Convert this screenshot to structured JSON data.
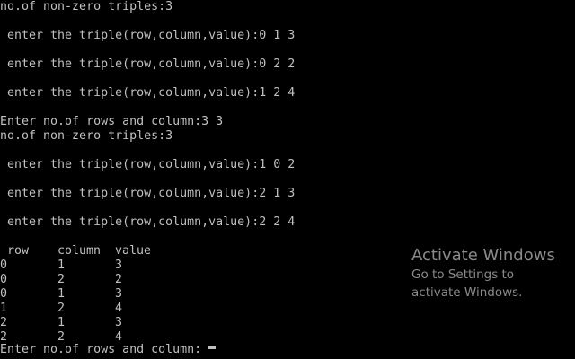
{
  "colors": {
    "background": "#000000",
    "console_text": "#c0c0c0",
    "watermark_text": "#8a8a8a"
  },
  "console": {
    "lines": [
      "no.of non-zero triples:3",
      "",
      " enter the triple(row,column,value):0 1 3",
      "",
      " enter the triple(row,column,value):0 2 2",
      "",
      " enter the triple(row,column,value):1 2 4",
      "",
      "Enter no.of rows and column:3 3",
      "no.of non-zero triples:3",
      "",
      " enter the triple(row,column,value):1 0 2",
      "",
      " enter the triple(row,column,value):2 1 3",
      "",
      " enter the triple(row,column,value):2 2 4",
      ""
    ],
    "table": {
      "headers": [
        "row",
        "column",
        "value"
      ],
      "rows": [
        [
          "0",
          "1",
          "3"
        ],
        [
          "0",
          "2",
          "2"
        ],
        [
          "0",
          "1",
          "3"
        ],
        [
          "1",
          "2",
          "4"
        ],
        [
          "2",
          "1",
          "3"
        ],
        [
          "2",
          "2",
          "4"
        ]
      ]
    },
    "prompt": "Enter no.of rows and column:"
  },
  "watermark": {
    "title": "Activate Windows",
    "line1": "Go to Settings to",
    "line2": "activate Windows."
  }
}
